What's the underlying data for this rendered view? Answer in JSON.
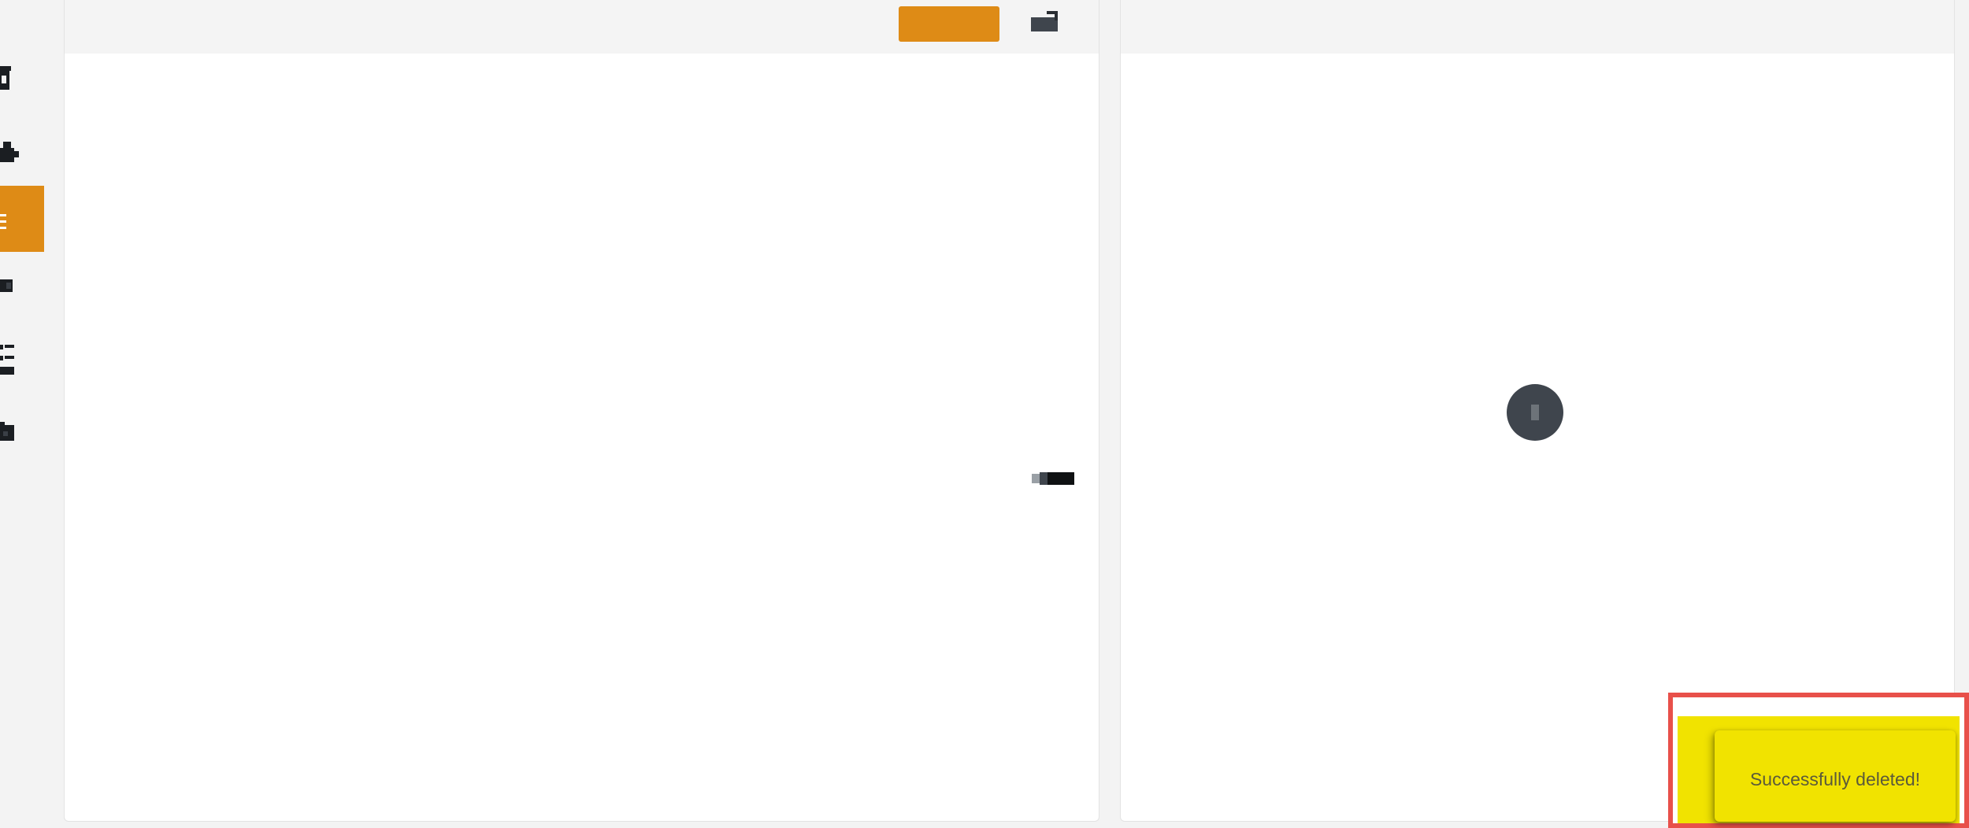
{
  "sidebar": {
    "items": [
      {
        "icon": "document-icon"
      },
      {
        "icon": "puzzle-icon"
      },
      {
        "icon": "list-icon",
        "active": true
      },
      {
        "icon": "flag-icon"
      },
      {
        "icon": "checklist-icon"
      },
      {
        "icon": "folder-icon"
      }
    ]
  },
  "left_panel": {
    "title": "",
    "primary_button": "",
    "content": []
  },
  "right_panel": {
    "title": "",
    "empty_message": ""
  },
  "toast": {
    "message": "Successfully deleted!",
    "color": "#f1e300",
    "highlight_color": "#e8504a"
  },
  "colors": {
    "accent": "#de8b16",
    "background": "#f3f3f3"
  }
}
